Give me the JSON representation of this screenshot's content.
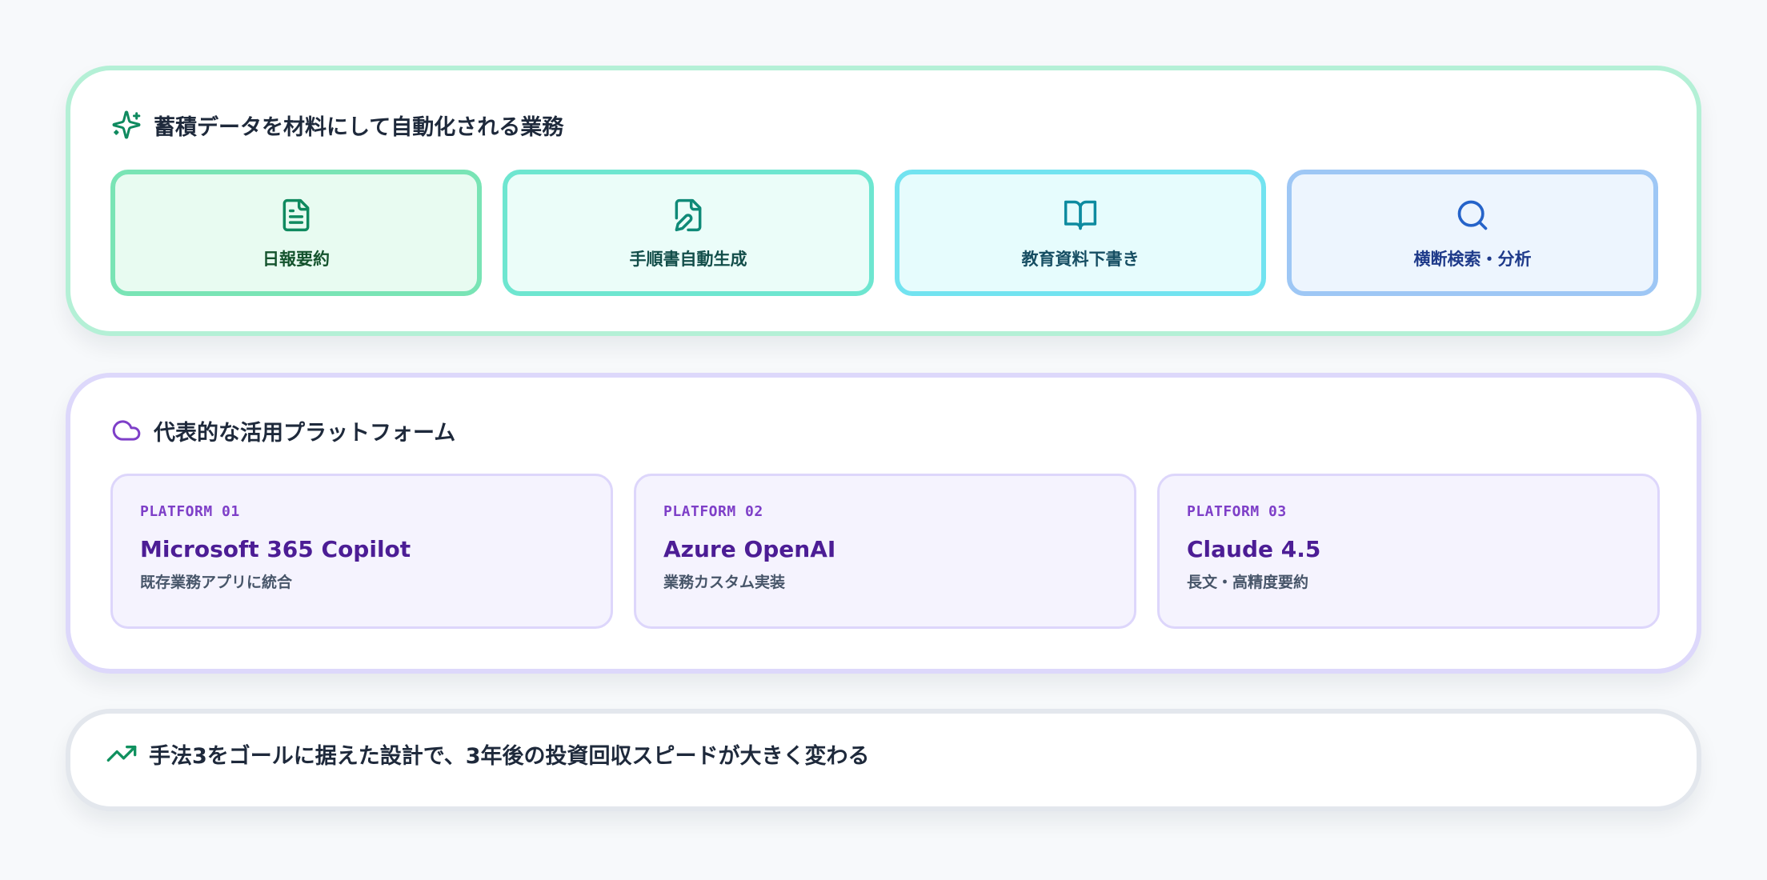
{
  "automation": {
    "title": "蓄積データを材料にして自動化される業務",
    "icon": "sparkles-icon",
    "tasks": [
      {
        "label": "日報要約",
        "icon": "file-text-icon"
      },
      {
        "label": "手順書自動生成",
        "icon": "file-pen-icon"
      },
      {
        "label": "教育資料下書き",
        "icon": "book-open-icon"
      },
      {
        "label": "横断検索・分析",
        "icon": "search-icon"
      }
    ]
  },
  "platforms": {
    "title": "代表的な活用プラットフォーム",
    "icon": "cloud-icon",
    "items": [
      {
        "tag": "PLATFORM 01",
        "name": "Microsoft 365 Copilot",
        "desc": "既存業務アプリに統合"
      },
      {
        "tag": "PLATFORM 02",
        "name": "Azure OpenAI",
        "desc": "業務カスタム実装"
      },
      {
        "tag": "PLATFORM 03",
        "name": "Claude 4.5",
        "desc": "長文・高精度要約"
      }
    ]
  },
  "conclusion": {
    "text": "手法3をゴールに据えた設計で、3年後の投資回収スピードが大きく変わる",
    "icon": "trending-up-icon"
  },
  "colors": {
    "accent_green": "#10915f",
    "accent_purple": "#7e3fc8"
  }
}
